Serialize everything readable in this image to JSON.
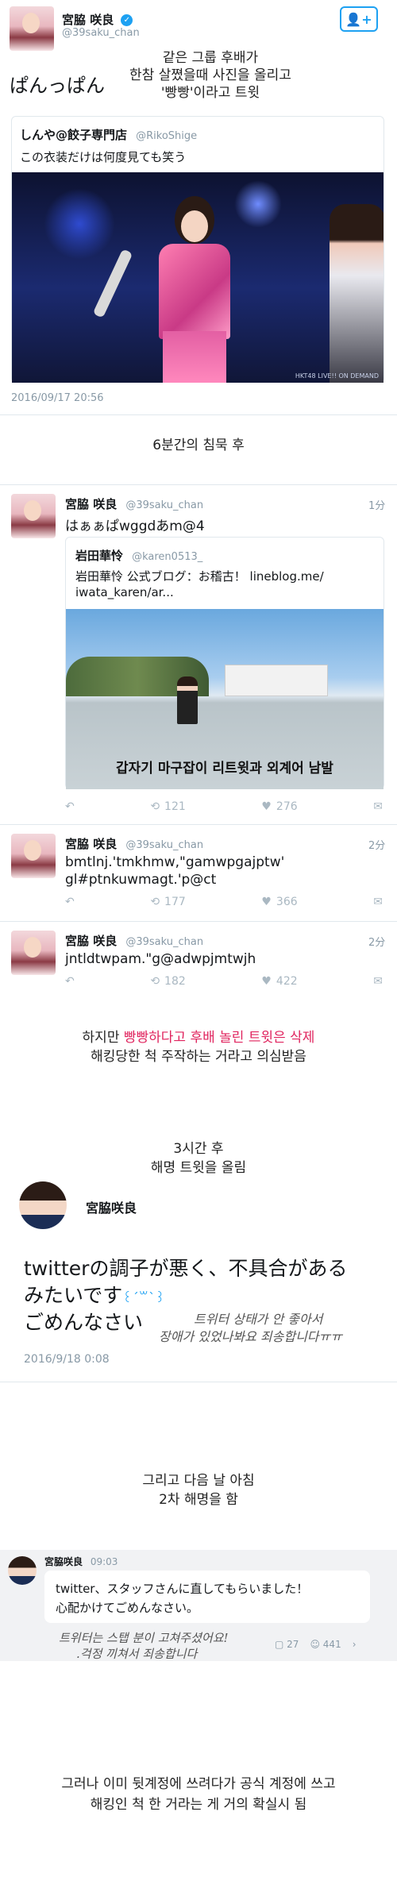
{
  "tweet1": {
    "name": "宮脇 咲良",
    "handle": "@39saku_chan",
    "text": "ぱんっぱん",
    "timestamp": "2016/09/17 20:56",
    "caption_lines": [
      "같은 그룹 후배가",
      "한참 살쪘을때 사진을 올리고",
      "'빵빵'이라고 트윗"
    ],
    "quote": {
      "name": "しんや@餃子専門店",
      "handle": "@RikoShige",
      "text": "この衣装だけは何度見ても笑う",
      "watermark": "HKT48 LIVE!! ON DEMAND"
    }
  },
  "caption_silence": "6분간의 침묵 후",
  "tweets": [
    {
      "name": "宮脇 咲良",
      "handle": "@39saku_chan",
      "time": "1分",
      "text": "はぁぁぱwggdあm@4",
      "quote": {
        "name": "岩田華怜",
        "handle": "@karen0513_",
        "text_line1": "岩田華怜 公式ブログ：お稽古！ lineblog.me/",
        "text_line2": "iwata_karen/ar...",
        "overlay": "갑자기 마구잡이 리트윗과 외계어 남발"
      },
      "retweets": "121",
      "likes": "276"
    },
    {
      "name": "宮脇 咲良",
      "handle": "@39saku_chan",
      "time": "2分",
      "text_line1": "bmtlnj.'tmkhmw,\"gamwpgajptw'",
      "text_line2": "gl#ptnkuwmagt.'p@ct",
      "retweets": "177",
      "likes": "366"
    },
    {
      "name": "宮脇 咲良",
      "handle": "@39saku_chan",
      "time": "2分",
      "text": "jntldtwpam.\"g@adwpjmtwjh",
      "retweets": "182",
      "likes": "422"
    }
  ],
  "caption_delete": {
    "prefix": "하지만 ",
    "highlight": "빵빵하다고 후배 놀린 트윗은 삭제",
    "line2": "해킹당한 척 주작하는 거라고 의심받음"
  },
  "caption_3h": [
    "3시간 후",
    "해명 트윗을 올림"
  ],
  "tweet_explain": {
    "name": "宮脇咲良",
    "text_line1": "twitterの調子が悪く、不具合がある",
    "text_line2": "みたいです",
    "text_line3": "ごめんなさい",
    "handwritten_line1": "트위터 상태가 안 좋아서",
    "handwritten_line2": "장애가 있었나봐요 죄송합니다ㅠㅠ",
    "timestamp": "2016/9/18 0:08"
  },
  "caption_morning": [
    "그리고 다음 날 아침",
    "2차 해명을 함"
  ],
  "tweet_second": {
    "name": "宮脇咲良",
    "time": "09:03",
    "text_line1": "twitter、スタッフさんに直してもらいました！",
    "text_line2": "心配かけてごめんなさい。",
    "handwritten_line1": "트위터는 스탭 분이 고쳐주셨어요!",
    "handwritten_line2": ".걱정 끼쳐서 죄송합니다",
    "comments": "27",
    "likes": "441"
  },
  "caption_final": [
    "그러나 이미 뒷계정에 쓰려다가 공식 계정에 쓰고",
    "해킹인 척 한 거라는 게 거의 확실시 됨"
  ],
  "colors": {
    "accent": "#1da1f2",
    "highlight_red": "#e0245e",
    "muted": "#8899a6"
  },
  "icons": [
    "verified-icon",
    "follow-user-icon",
    "reply-icon",
    "retweet-icon",
    "like-icon",
    "dm-icon",
    "comment-icon",
    "chevron-right-icon"
  ]
}
